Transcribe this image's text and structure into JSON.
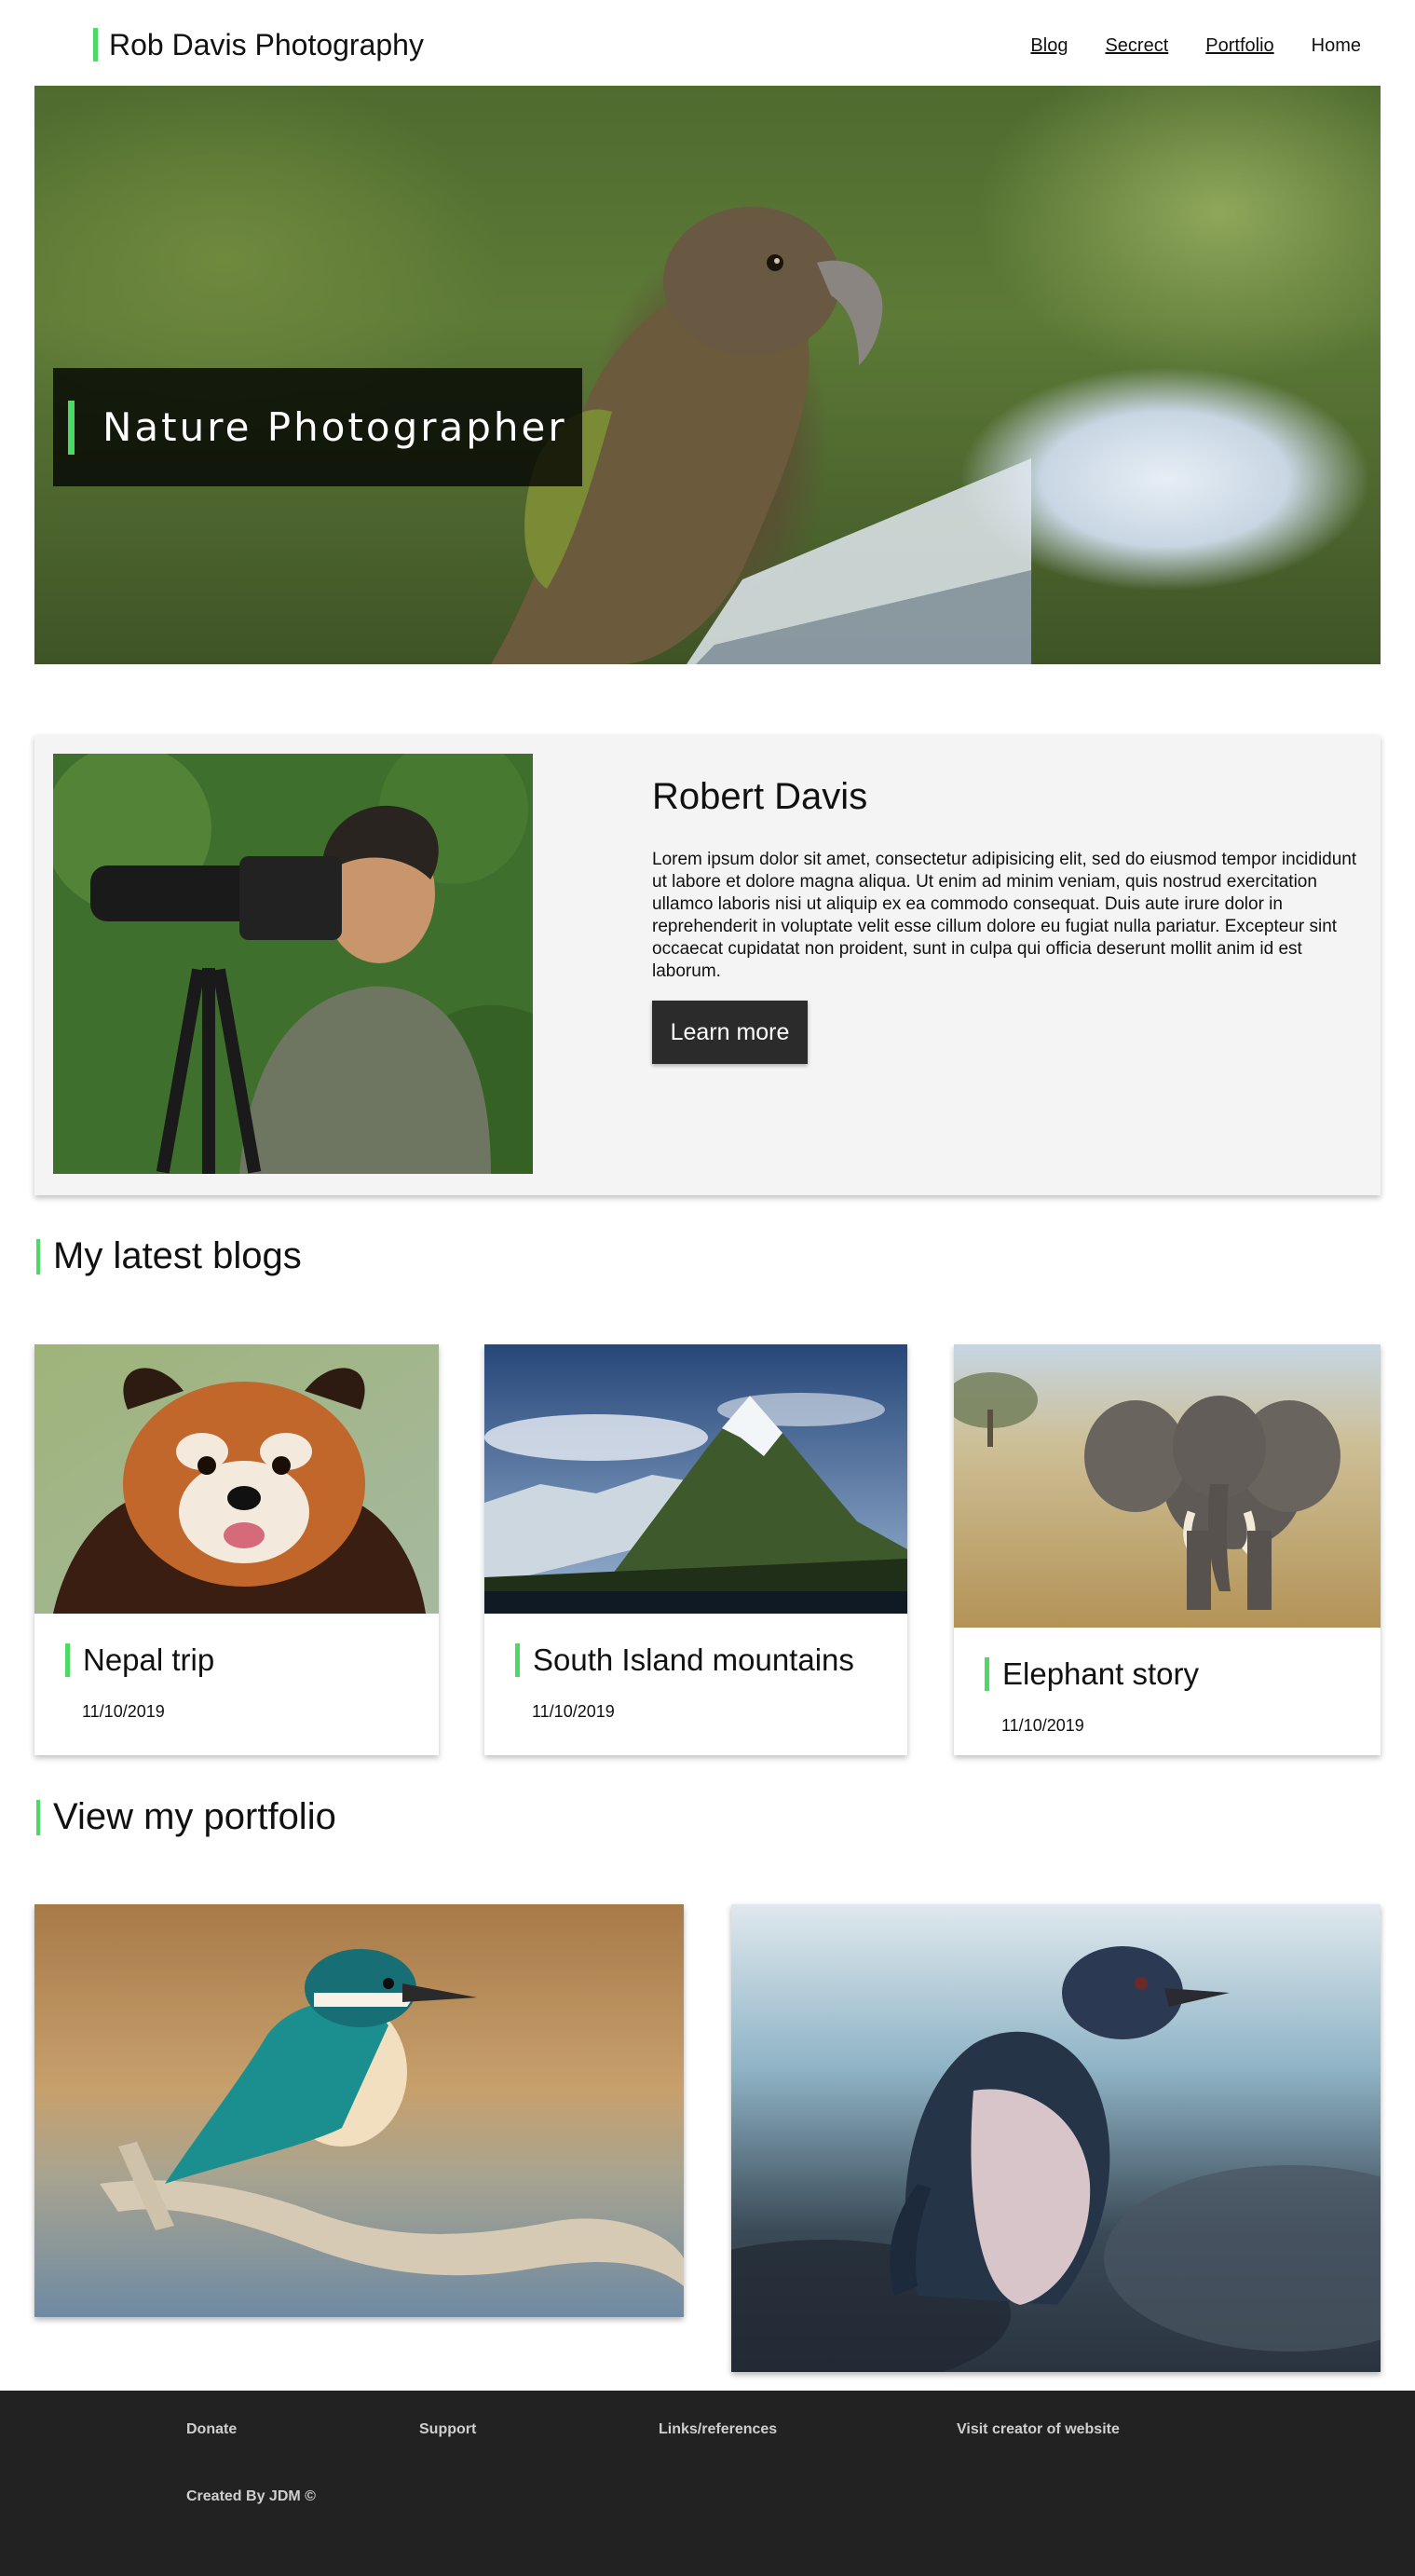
{
  "header": {
    "brand": "Rob Davis Photography",
    "nav": [
      "Blog",
      "Secrect",
      "Portfolio",
      "Home"
    ]
  },
  "hero": {
    "caption": "Nature Photographer"
  },
  "about": {
    "name": "Robert Davis",
    "text": "Lorem ipsum dolor sit amet, consectetur adipisicing elit, sed do eiusmod tempor incididunt ut labore et dolore magna aliqua. Ut enim ad minim veniam, quis nostrud exercitation ullamco laboris nisi ut aliquip ex ea commodo consequat. Duis aute irure dolor in reprehenderit in voluptate velit esse cillum dolore eu fugiat nulla pariatur. Excepteur sint occaecat cupidatat non proident, sunt in culpa qui officia deserunt mollit anim id est laborum.",
    "button": "Learn more"
  },
  "blogs": {
    "heading": "My latest blogs",
    "items": [
      {
        "title": "Nepal trip",
        "date": "11/10/2019"
      },
      {
        "title": "South Island mountains",
        "date": "11/10/2019"
      },
      {
        "title": "Elephant story",
        "date": "11/10/2019"
      }
    ]
  },
  "portfolio": {
    "heading": "View my portfolio"
  },
  "footer": {
    "links": [
      "Donate",
      "Support",
      "Links/references",
      "Visit creator of website"
    ],
    "credit": "Created By JDM ©"
  },
  "colors": {
    "accent": "#4cd964",
    "footer_bg": "#222222",
    "button_bg": "#2b2b2b"
  }
}
